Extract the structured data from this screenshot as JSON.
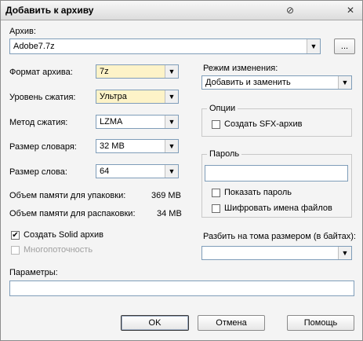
{
  "window": {
    "title": "Добавить к архиву"
  },
  "archive": {
    "label": "Архив:",
    "value": "Adobe7.7z",
    "browse_label": "..."
  },
  "format": {
    "label": "Формат архива:",
    "value": "7z"
  },
  "level": {
    "label": "Уровень сжатия:",
    "value": "Ультра"
  },
  "method": {
    "label": "Метод сжатия:",
    "value": "LZMA"
  },
  "dict": {
    "label": "Размер словаря:",
    "value": "32 MB"
  },
  "word": {
    "label": "Размер слова:",
    "value": "64"
  },
  "memory": {
    "pack_label": "Объем памяти для упаковки:",
    "pack_value": "369 MB",
    "unpack_label": "Объем памяти для распаковки:",
    "unpack_value": "34 MB"
  },
  "solid": {
    "label": "Создать Solid архив",
    "checked": true
  },
  "multithread": {
    "label": "Многопоточность",
    "checked": false,
    "disabled": true
  },
  "params": {
    "label": "Параметры:",
    "value": ""
  },
  "update_mode": {
    "label": "Режим изменения:",
    "value": "Добавить и заменить"
  },
  "options": {
    "title": "Опции",
    "sfx_label": "Создать SFX-архив"
  },
  "password": {
    "title": "Пароль",
    "show_label": "Показать пароль",
    "encrypt_label": "Шифровать имена файлов"
  },
  "split": {
    "label": "Разбить на тома размером (в байтах):",
    "value": ""
  },
  "buttons": {
    "ok": "OK",
    "cancel": "Отмена",
    "help": "Помощь"
  },
  "icons": {
    "help": "help-icon",
    "close": "close-icon",
    "checkmark": "✔"
  }
}
